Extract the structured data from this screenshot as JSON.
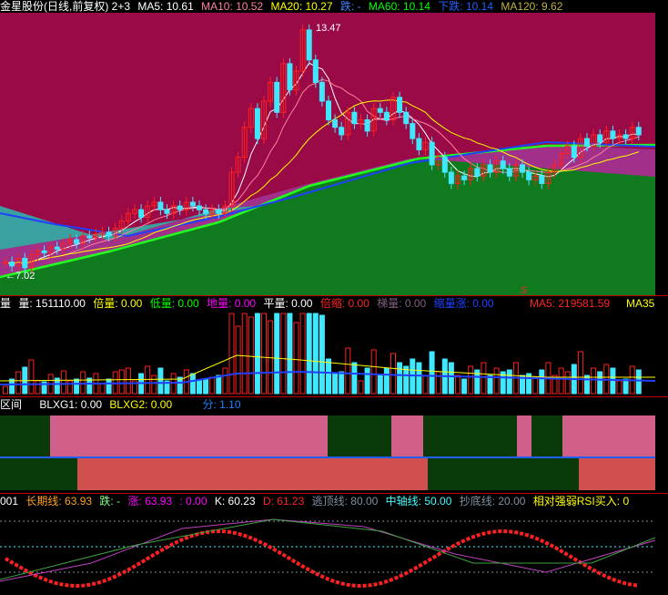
{
  "header": {
    "title": "金星股份(日线,前复权) 2+3",
    "ma5": "MA5: 10.61",
    "ma10": "MA10: 10.52",
    "ma20": "MA20: 10.27",
    "die": "跌: -",
    "ma60": "MA60: 10.14",
    "xiadie": "下跌: 10.14",
    "ma120": "MA120: 9.62"
  },
  "main": {
    "high_label": "13.47",
    "low_label": "←7.02",
    "s_mark": "S"
  },
  "volume": {
    "label": "量",
    "vol": "量: 151110.00",
    "beiliang": "倍量: 0.00",
    "diliang": "低量: 0.00",
    "diliang2": "地量: 0.00",
    "pingliang": "平量: 0.00",
    "beisuo": "倍缩: 0.00",
    "tiliang": "梯量: 0.00",
    "suoliangzhang": "缩量涨: 0.00",
    "ma5": "MA5: 219581.59",
    "ma35": "MA35"
  },
  "blx": {
    "label": "区间",
    "g1": "BLXG1: 0.00",
    "g2": "BLXG2: 0.00",
    "fen": "分: 1.10"
  },
  "rsi": {
    "label": "001",
    "changqi": "长期线: 63.93",
    "die": "跌: -",
    "zhang": "涨: 63.93",
    "x": ": 0.00",
    "k": "K: 60.23",
    "d": "D: 61.23",
    "taoding": "逃顶线: 80.00",
    "zhongzhou": "中轴线: 50.00",
    "chaodi": "抄底线: 20.00",
    "buy": "相对强弱RSI买入: 0"
  },
  "colors": {
    "bg_top": "#9a0a46",
    "purple": "#a0308a",
    "teal": "#3aa0a0",
    "green": "#0f7a1e",
    "up": "#ff2020",
    "down": "#40e8ff"
  },
  "chart_data": {
    "type": "candlestick",
    "closes": [
      7.2,
      7.1,
      7.3,
      7.05,
      7.4,
      7.5,
      7.45,
      7.6,
      7.55,
      7.7,
      7.8,
      7.7,
      7.9,
      7.85,
      7.95,
      8.0,
      7.9,
      8.1,
      8.3,
      8.5,
      8.6,
      8.4,
      8.7,
      8.8,
      8.6,
      8.5,
      8.7,
      8.6,
      8.8,
      8.7,
      8.6,
      8.5,
      8.6,
      8.5,
      8.7,
      9.6,
      10.0,
      10.8,
      11.3,
      10.5,
      11.5,
      12.0,
      11.2,
      12.5,
      11.8,
      12.3,
      13.4,
      12.6,
      12.0,
      11.5,
      11.0,
      10.8,
      10.6,
      11.2,
      10.9,
      11.0,
      10.7,
      11.3,
      11.2,
      11.0,
      11.6,
      11.2,
      10.9,
      10.5,
      10.2,
      10.4,
      9.8,
      10.0,
      9.6,
      9.3,
      9.5,
      9.4,
      9.7,
      9.5,
      9.8,
      9.6,
      9.9,
      9.7,
      9.5,
      9.8,
      9.6,
      9.4,
      9.5,
      9.3,
      9.6,
      9.8,
      10.1,
      10.3,
      10.0,
      10.5,
      10.3,
      10.6,
      10.4,
      10.7,
      10.5,
      10.6,
      10.5,
      10.8,
      10.6
    ],
    "price_range": [
      7.02,
      13.47
    ]
  }
}
